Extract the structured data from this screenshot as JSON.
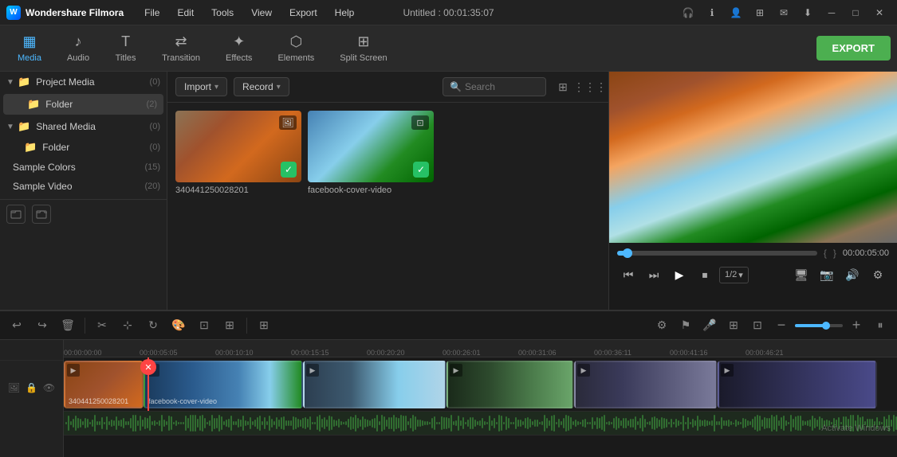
{
  "app": {
    "name": "Wondershare Filmora",
    "title": "Untitled : 00:01:35:07"
  },
  "menubar": {
    "items": [
      "File",
      "Edit",
      "Tools",
      "View",
      "Export",
      "Help"
    ]
  },
  "toolbar": {
    "buttons": [
      {
        "id": "media",
        "label": "Media",
        "icon": "🎬",
        "active": true
      },
      {
        "id": "audio",
        "label": "Audio",
        "icon": "🎵",
        "active": false
      },
      {
        "id": "titles",
        "label": "Titles",
        "icon": "T",
        "active": false
      },
      {
        "id": "transition",
        "label": "Transition",
        "icon": "⇄",
        "active": false
      },
      {
        "id": "effects",
        "label": "Effects",
        "icon": "✦",
        "active": false
      },
      {
        "id": "elements",
        "label": "Elements",
        "icon": "⬡",
        "active": false
      },
      {
        "id": "splitscreen",
        "label": "Split Screen",
        "icon": "⊞",
        "active": false
      }
    ],
    "export_label": "EXPORT"
  },
  "sidebar": {
    "sections": [
      {
        "id": "project-media",
        "label": "Project Media",
        "count": "(0)",
        "expanded": true,
        "children": [
          {
            "id": "folder",
            "label": "Folder",
            "count": "(2)",
            "active": true
          }
        ]
      },
      {
        "id": "shared-media",
        "label": "Shared Media",
        "count": "(0)",
        "expanded": true,
        "children": [
          {
            "id": "folder2",
            "label": "Folder",
            "count": "(0)",
            "active": false
          }
        ]
      },
      {
        "id": "sample-colors",
        "label": "Sample Colors",
        "count": "(15)"
      },
      {
        "id": "sample-video",
        "label": "Sample Video",
        "count": "(20)"
      }
    ],
    "add_folder_label": "+",
    "remove_folder_label": "🗑"
  },
  "content": {
    "import_label": "Import",
    "record_label": "Record",
    "search_placeholder": "Search",
    "media_items": [
      {
        "id": "video1",
        "label": "340441250028201",
        "type": "image"
      },
      {
        "id": "video2",
        "label": "facebook-cover-video",
        "type": "screen"
      }
    ]
  },
  "preview": {
    "time": "00:00:05:00",
    "speed": "1/2",
    "controls": {
      "skip_back": "⏮",
      "step_back": "⏭",
      "play": "▶",
      "stop": "⏹",
      "skip_forward": "⏭"
    }
  },
  "timeline": {
    "current_time": "00:00:05:05",
    "ruler_marks": [
      "00:00:00:00",
      "00:00:05:05",
      "00:00:10:10",
      "00:00:15:15",
      "00:00:20:20",
      "00:00:26:01",
      "00:00:31:06",
      "00:00:36:11",
      "00:00:41:16",
      "00:00:46:21"
    ],
    "clips": [
      {
        "id": "clip1",
        "label": "340441250028201"
      },
      {
        "id": "clip2",
        "label": "facebook-cover-video"
      }
    ],
    "zoom_level": "65"
  },
  "colors": {
    "accent": "#4db8ff",
    "export_green": "#4CAF50",
    "playhead_red": "#ff4444",
    "folder_orange": "#e8a030",
    "check_green": "#26c165"
  }
}
